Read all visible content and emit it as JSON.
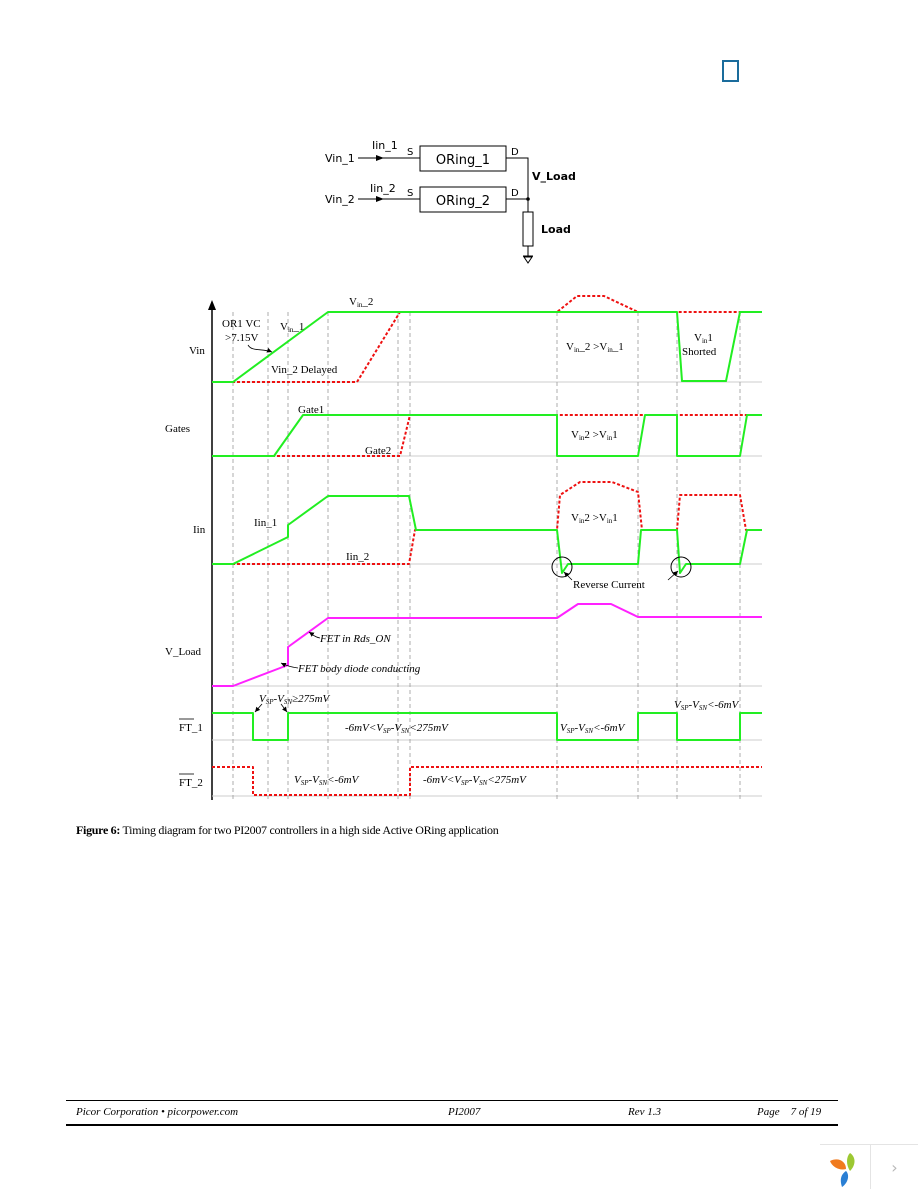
{
  "schematic": {
    "vin1": "Vin_1",
    "vin2": "Vin_2",
    "iin1": "Iin_1",
    "iin2": "Iin_2",
    "block1": "ORing_1",
    "block2": "ORing_2",
    "source_pin": "S",
    "drain_pin": "D",
    "vload": "V_Load",
    "load": "Load"
  },
  "timing": {
    "row_labels": {
      "vin": "Vin",
      "gates": "Gates",
      "iin": "Iin",
      "vload": "V_Load",
      "ft1": "FT_1",
      "ft2": "FT_2"
    },
    "annotations": {
      "or1_vc_line1": "OR1 VC",
      "or1_vc_line2": ">7.15V",
      "vin_1": "Vin_1",
      "vin_2": "Vin_2",
      "vin2_delayed": "Vin_2 Delayed",
      "vin2_gt_vin1": "Vin_2 >Vin_1",
      "vin1_line1": "Vin1",
      "vin1_line2": "Shorted",
      "gate1": "Gate1",
      "gate2": "Gate2",
      "gates_vin2_gt_vin1": "Vin2 >Vin1",
      "iin_1": "Iin_1",
      "iin_2": "Iin_2",
      "iin_vin2_gt_vin1": "Vin2 >Vin1",
      "reverse_current": "Reverse Current",
      "fet_rds_on": "FET in Rds_ON",
      "fet_body_diode": "FET body diode conducting",
      "ft1_ge_275": "VSP-VSN≥275mV",
      "ft1_mid": "-6mV<VSP-VSN<275mV",
      "ft1_lt_neg6_a": "VSP-VSN<-6mV",
      "ft1_lt_neg6_b": "VSP-VSN<-6mV",
      "ft2_lt_neg6": "VSP-VSN<-6mV",
      "ft2_mid": "-6mV<VSP-VSN<275mV"
    },
    "colors": {
      "channel1": "#22ee22",
      "channel2": "#ee1111",
      "vload": "#ff22ff",
      "grid": "#999999"
    }
  },
  "caption": {
    "label": "Figure 6:",
    "text": " Timing diagram for two PI2007 controllers in a high side Active ORing application"
  },
  "footer": {
    "company": "Picor Corporation • picorpower.com",
    "part": "PI2007",
    "rev": "Rev 1.3",
    "page": "Page    7 of 19"
  },
  "viewer": {
    "next_label": "›"
  }
}
